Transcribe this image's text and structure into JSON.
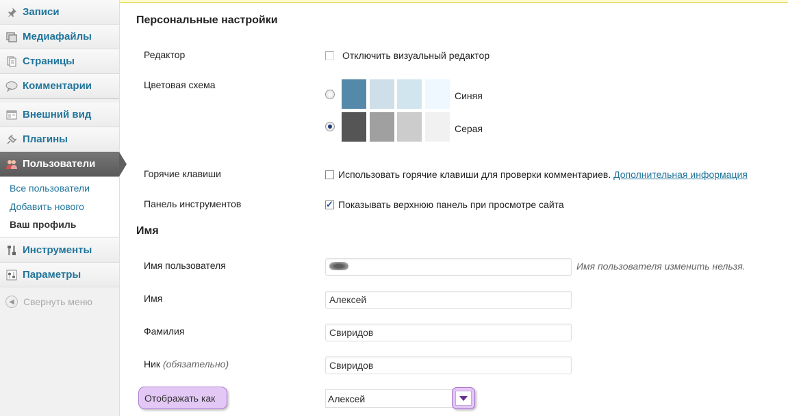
{
  "sidebar": {
    "items": [
      {
        "label": "Записи",
        "icon": "pushpin-icon"
      },
      {
        "label": "Медиафайлы",
        "icon": "media-icon"
      },
      {
        "label": "Страницы",
        "icon": "pages-icon"
      },
      {
        "label": "Комментарии",
        "icon": "comment-bubble-icon"
      },
      {
        "label": "Внешний вид",
        "icon": "appearance-icon"
      },
      {
        "label": "Плагины",
        "icon": "plug-icon"
      },
      {
        "label": "Пользователи",
        "icon": "users-icon"
      },
      {
        "label": "Инструменты",
        "icon": "tools-icon"
      },
      {
        "label": "Параметры",
        "icon": "settings-icon"
      }
    ],
    "submenu": {
      "all_users": "Все пользователи",
      "add_new": "Добавить нового",
      "your_profile": "Ваш профиль"
    },
    "collapse_label": "Свернуть меню"
  },
  "personal": {
    "heading": "Персональные настройки",
    "editor_label": "Редактор",
    "editor_checkbox": "Отключить визуальный редактор",
    "scheme_label": "Цветовая схема",
    "scheme_blue": "Синяя",
    "scheme_gray": "Серая",
    "blue_colors": [
      "#5589aa",
      "#cfdfe9",
      "#d1e5ee",
      "#eff8ff"
    ],
    "gray_colors": [
      "#555555",
      "#a0a0a0",
      "#cccccc",
      "#f1f1f1"
    ],
    "hotkeys_label": "Горячие клавиши",
    "hotkeys_checkbox": "Использовать горячие клавиши для проверки комментариев.",
    "hotkeys_link": "Дополнительная информация",
    "toolbar_label": "Панель инструментов",
    "toolbar_checkbox": "Показывать верхнюю панель при просмотре сайта"
  },
  "name": {
    "heading": "Имя",
    "username_label": "Имя пользователя",
    "username_note": "Имя пользователя изменить нельзя.",
    "first_label": "Имя",
    "first_value": "Алексей",
    "last_label": "Фамилия",
    "last_value": "Свиридов",
    "nick_label": "Ник",
    "nick_required": "(обязательно)",
    "nick_value": "Свиридов",
    "display_label": "Отображать как",
    "display_value": "Алексей"
  }
}
